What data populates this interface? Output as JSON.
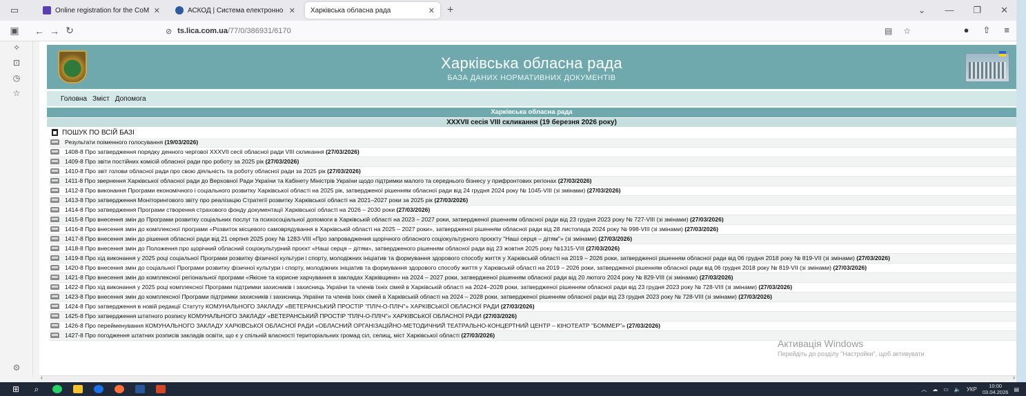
{
  "browser": {
    "tabs": [
      {
        "title": "Online registration for the CoM",
        "favicon_color": "#5a3fb0",
        "active": false
      },
      {
        "title": "АСКОД | Система електронно",
        "favicon_color": "#2c5aa0",
        "active": false
      },
      {
        "title": "Харківська обласна рада",
        "favicon_color": "#ffffff",
        "active": true
      }
    ],
    "url_host": "ts.lica.com.ua",
    "url_path": "/77/0/386931/6170"
  },
  "site": {
    "title": "Харківська обласна рада",
    "subtitle": "БАЗА ДАНИХ НОРМАТИВНИХ ДОКУМЕНТІВ",
    "menu": [
      "Головна",
      "Зміст",
      "Допомога"
    ],
    "header1": "Харківська обласна рада",
    "header2": "XXXVII сесія VIII скликання (19 березня 2026 року)",
    "search_all": "ПОШУК ПО ВСІЙ БАЗІ"
  },
  "documents": [
    {
      "text": "Результати поіменного голосування",
      "date": "(19/03/2026)"
    },
    {
      "text": "1408-8 Про затвердження порядку денного чергової XXXVII сесії обласної ради VIII скликання",
      "date": "(27/03/2026)"
    },
    {
      "text": "1409-8 Про звіти постійних комісій обласної ради про роботу за 2025 рік",
      "date": "(27/03/2026)"
    },
    {
      "text": "1410-8 Про звіт голови обласної ради про свою діяльність та роботу обласної ради за 2025 рік",
      "date": "(27/03/2026)"
    },
    {
      "text": "1411-8 Про звернення Харківської обласної ради до Верховної Ради України та Кабінету Міністрів України щодо підтримки малого та середнього бізнесу у прифронтових регіонах",
      "date": "(27/03/2026)"
    },
    {
      "text": "1412-8 Про виконання Програми економічного і соціального розвитку Харківської області на 2025 рік, затвердженої рішенням обласної ради від 24 грудня 2024 року № 1045-VIII (зі змінами)",
      "date": "(27/03/2026)"
    },
    {
      "text": "1413-8 Про затвердження Моніторингового звіту про реалізацію Стратегії розвитку Харківської області на 2021–2027 роки за 2025 рік",
      "date": "(27/03/2026)"
    },
    {
      "text": "1414-8 Про затвердження Програми створення страхового фонду документації Харківської області на 2026 – 2030 роки",
      "date": "(27/03/2026)"
    },
    {
      "text": "1415-8 Про внесення змін до Програми розвитку соціальних послуг та психосоціальної допомоги в Харківській області на 2023 – 2027 роки, затвердженої рішенням обласної ради від 23 грудня 2023 року № 727-VIII (зі змінами)",
      "date": "(27/03/2026)"
    },
    {
      "text": "1416-8 Про внесення змін до комплексної програми «Розвиток місцевого самоврядування в Харківській області на 2025 – 2027 роки», затвердженої рішенням обласної ради від 28 листопада 2024 року № 998-VIII (зі змінами)",
      "date": "(27/03/2026)"
    },
    {
      "text": "1417-8 Про внесення змін до рішення обласної ради від 21 серпня 2025 року № 1283-VIII «Про запровадження щорічного обласного соціокультурного проєкту \"Наші серця – дітям\"» (зі змінами)",
      "date": "(27/03/2026)"
    },
    {
      "text": "1418-8 Про внесення змін до Положення про щорічний обласний соціокультурний проєкт «Наші серця – дітям», затвердженого рішенням обласної ради від 23 жовтня 2025 року №1315-VIII",
      "date": "(27/03/2026)"
    },
    {
      "text": "1419-8 Про хід виконання у 2025 році соціальної Програми розвитку фізичної культури і спорту, молодіжних ініціатив та формування здорового способу життя у Харківській області на 2019 – 2026 роки, затвердженої рішенням обласної ради від 06 грудня 2018 року № 819-VII (зі змінами)",
      "date": "(27/03/2026)"
    },
    {
      "text": "1420-8 Про внесення змін до соціальної Програми розвитку фізичної культури і спорту, молодіжних ініціатив та формування здорового способу життя у Харківській області на 2019 – 2026 роки, затвердженої рішенням обласної ради від 06 грудня 2018 року № 819-VII (зі змінами)",
      "date": "(27/03/2026)"
    },
    {
      "text": "1421-8 Про внесення змін до комплексної регіональної програми «Якісне та корисне харчування в закладах Харківщини» на 2024 – 2027 роки, затвердженої рішенням обласної ради від 20 лютого 2024 року № 829-VIII (зі змінами)",
      "date": "(27/03/2026)"
    },
    {
      "text": "1422-8 Про хід виконання у 2025 році комплексної Програми підтримки захисників і захисниць України та членів їхніх сімей в Харківській області на 2024–2028 роки, затвердженої рішенням обласної ради від 23 грудня 2023 року № 728-VIII (зі змінами)",
      "date": "(27/03/2026)"
    },
    {
      "text": "1423-8 Про внесення змін до комплексної Програми підтримки захисників і захисниць України та членів їхніх сімей в Харківській області на 2024 – 2028 роки, затвердженої рішенням обласної ради від 23 грудня 2023 року № 728-VIII (зі змінами)",
      "date": "(27/03/2026)"
    },
    {
      "text": "1424-8 Про затвердження в новій редакції Статуту КОМУНАЛЬНОГО ЗАКЛАДУ «ВЕТЕРАНСЬКИЙ ПРОСТІР \"ПЛІЧ-О-ПЛІЧ\"» ХАРКІВСЬКОЇ ОБЛАСНОЇ РАДИ",
      "date": "(27/03/2026)"
    },
    {
      "text": "1425-8 Про затвердження штатного розпису КОМУНАЛЬНОГО ЗАКЛАДУ «ВЕТЕРАНСЬКИЙ ПРОСТІР \"ПЛІЧ-О-ПЛІЧ\"» ХАРКІВСЬКОЇ ОБЛАСНОЇ РАДИ",
      "date": "(27/03/2026)"
    },
    {
      "text": "1426-8 Про перейменування КОМУНАЛЬНОГО ЗАКЛАДУ ХАРКІВСЬКОЇ ОБЛАСНОЇ РАДИ «ОБЛАСНИЙ ОРГАНІЗАЦІЙНО-МЕТОДИЧНИЙ ТЕАТРАЛЬНО-КОНЦЕРТНИЙ ЦЕНТР – КІНОТЕАТР \"БОММЕР\"»",
      "date": "(27/03/2026)"
    },
    {
      "text": "1427-8 Про погодження штатних розписів закладів освіти, що є у спільній власності територіальних громад сіл, селищ, міст Харківської області",
      "date": "(27/03/2026)"
    }
  ],
  "windows": {
    "activation_title": "Активація Windows",
    "activation_sub": "Перейдіть до розділу \"Настройки\", щоб активувати"
  },
  "taskbar": {
    "lang": "УКР",
    "time": "10:00",
    "date": "03.04.2026"
  },
  "colors": {
    "banner": "#6fa9ad",
    "menubar": "#d5e8e8",
    "header2": "#c6dede",
    "taskbar": "#1f2937"
  }
}
